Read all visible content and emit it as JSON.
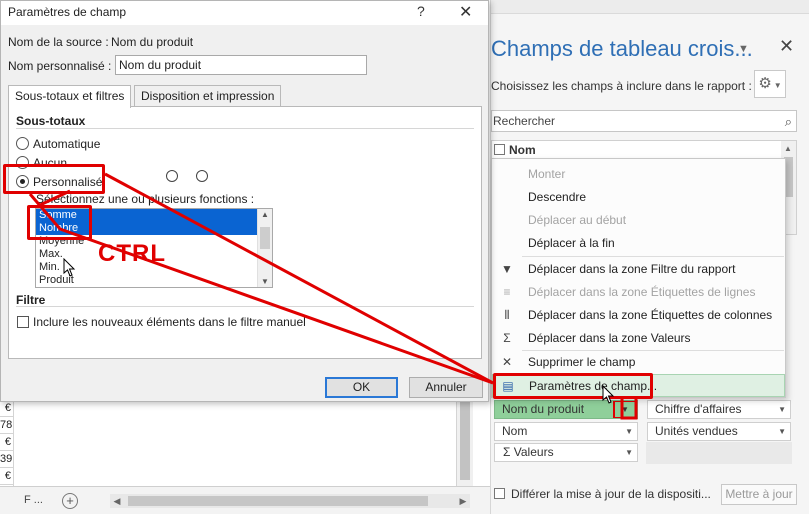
{
  "dialog": {
    "title": "Paramètres de champ",
    "help_glyph": "?",
    "close_glyph": "✕",
    "source_label": "Nom de la source :",
    "source_value": "Nom du produit",
    "custom_name_label": "Nom personnalisé :",
    "custom_name_value": "Nom du produit",
    "tabs": [
      {
        "label": "Sous-totaux et filtres",
        "selected": true
      },
      {
        "label": "Disposition et impression",
        "selected": false
      }
    ],
    "subtotals_heading": "Sous-totaux",
    "radio_automatic": "Automatique",
    "radio_none": "Aucun",
    "radio_custom": "Personnalisé",
    "functions_label": "Sélectionnez une ou plusieurs fonctions :",
    "functions": [
      "Somme",
      "Nombre",
      "Moyenne",
      "Max.",
      "Min.",
      "Produit"
    ],
    "selected_functions": [
      "Somme",
      "Nombre"
    ],
    "filter_heading": "Filtre",
    "filter_checkbox_label": "Inclure les nouveaux éléments dans le filtre manuel",
    "ok_label": "OK",
    "cancel_label": "Annuler"
  },
  "annotation": {
    "ctrl_label": "CTRL",
    "color": "#e00000"
  },
  "pane": {
    "title": "Champs de tableau crois...",
    "close_glyph": "✕",
    "subtitle": "Choisissez les champs à inclure dans le rapport :",
    "search_placeholder": "Rechercher",
    "field_nom": "Nom",
    "zones": {
      "rows_field_active": "Nom du produit",
      "rows_field_2": "Nom",
      "values_field_1": "Chiffre d'affaires",
      "values_field_2": "Unités vendues",
      "values_header": "Valeurs"
    },
    "defer_label": "Différer la mise à jour de la dispositi...",
    "update_label": "Mettre à jour",
    "title_color": "#2f6fb5"
  },
  "context_menu": {
    "items": [
      {
        "label": "Monter",
        "disabled": true,
        "icon": ""
      },
      {
        "label": "Descendre",
        "disabled": false,
        "icon": ""
      },
      {
        "label": "Déplacer au début",
        "disabled": true,
        "icon": ""
      },
      {
        "label": "Déplacer à la fin",
        "disabled": false,
        "icon": ""
      },
      {
        "label": "Déplacer dans la zone Filtre du rapport",
        "disabled": false,
        "icon": "filter-icon"
      },
      {
        "label": "Déplacer dans la zone Étiquettes de lignes",
        "disabled": true,
        "icon": "rows-icon"
      },
      {
        "label": "Déplacer dans la zone Étiquettes de colonnes",
        "disabled": false,
        "icon": "columns-icon"
      },
      {
        "label": "Déplacer dans la zone Valeurs",
        "disabled": false,
        "icon": "sigma-icon"
      },
      {
        "label": "Supprimer le champ",
        "disabled": false,
        "icon": "delete-icon"
      },
      {
        "label": "Paramètres de champ...",
        "disabled": false,
        "icon": "field-settings-icon"
      }
    ]
  },
  "sheet": {
    "cells": [
      "€",
      "78",
      "€",
      "39",
      "€"
    ],
    "sheet_tab_ellipsis": "F ...",
    "add_sheet_glyph": "+"
  }
}
